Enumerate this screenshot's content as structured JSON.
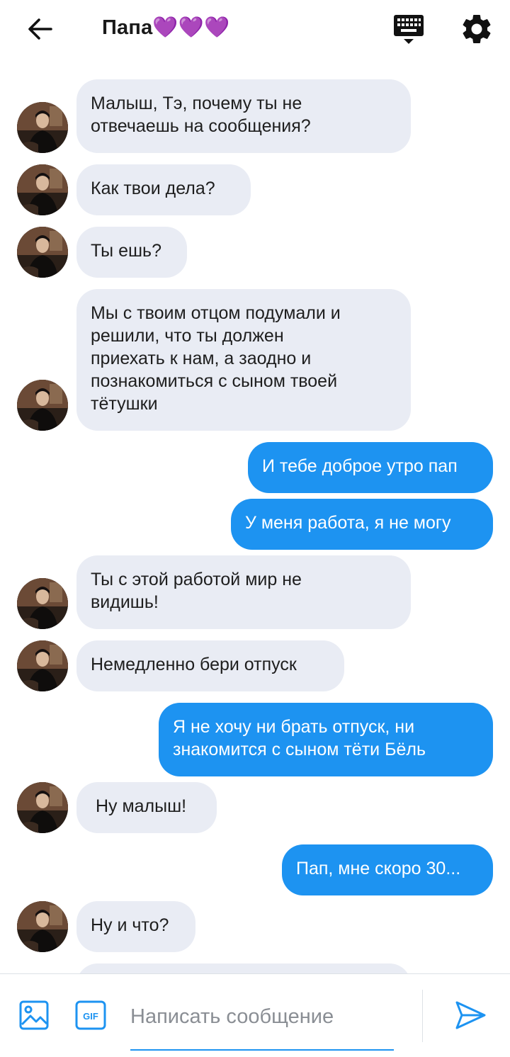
{
  "header": {
    "title": "Папа💜💜💜",
    "back_icon": "arrow-left-icon",
    "keyboard_icon": "keyboard-hide-icon",
    "settings_icon": "gear-icon"
  },
  "messages": [
    {
      "side": "in",
      "text": "Малыш, Тэ, почему ты не\nотвечаешь на сообщения?"
    },
    {
      "side": "in",
      "text": "Как твои дела?"
    },
    {
      "side": "in",
      "text": "Ты ешь?"
    },
    {
      "side": "in",
      "text": "Мы с твоим отцом подумали и\nрешили, что ты должен\nприехать к нам, а заодно и\nпознакомиться с сыном твоей\nтётушки"
    },
    {
      "side": "out",
      "text": "И тебе доброе утро пап"
    },
    {
      "side": "out",
      "text": "У меня работа, я не могу"
    },
    {
      "side": "in",
      "text": "Ты с этой работой мир не\nвидишь!"
    },
    {
      "side": "in",
      "text": "Немедленно бери отпуск"
    },
    {
      "side": "out",
      "text": "Я не хочу ни брать отпуск, ни\nзнакомится с сыном тёти Бёль"
    },
    {
      "side": "in",
      "text": " Ну малыш!"
    },
    {
      "side": "out",
      "text": "Пап, мне скоро 30..."
    },
    {
      "side": "in",
      "text": "Ну и что?"
    },
    {
      "side": "in",
      "text": ""
    }
  ],
  "composer": {
    "placeholder": "Написать сообщение",
    "value": "",
    "gif_label": "GIF",
    "image_icon": "image-icon",
    "send_icon": "send-icon"
  },
  "colors": {
    "accent": "#1d93f1",
    "incoming_bubble": "#e9ecf4",
    "outgoing_bubble": "#1d93f1"
  }
}
